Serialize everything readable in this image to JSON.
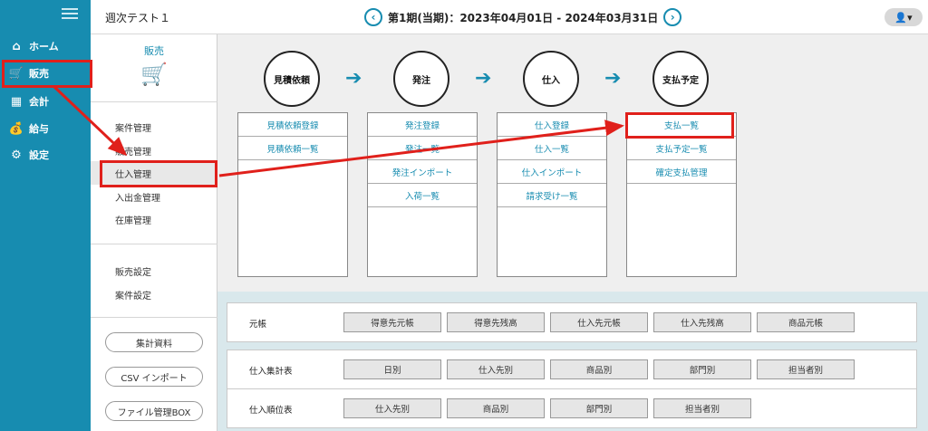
{
  "header": {
    "app_title": "週次テスト１",
    "period": "第1期(当期)：2023年04月01日 - 2024年03月31日",
    "prev_glyph": "‹",
    "next_glyph": "›",
    "user_glyph": "👤▾"
  },
  "nav": {
    "items": [
      {
        "label": "ホーム",
        "icon": "home-icon",
        "glyph": "⌂"
      },
      {
        "label": "販売",
        "icon": "cart-icon",
        "glyph": "🛒"
      },
      {
        "label": "会計",
        "icon": "calculator-icon",
        "glyph": "▦"
      },
      {
        "label": "給与",
        "icon": "money-bag-icon",
        "glyph": "💰"
      },
      {
        "label": "設定",
        "icon": "gear-icon",
        "glyph": "⚙"
      }
    ]
  },
  "submenu": {
    "title": "販売",
    "cart_glyph": "🛒",
    "items": [
      "案件管理",
      "販売管理",
      "仕入管理",
      "入出金管理",
      "在庫管理"
    ],
    "settings": [
      "販売設定",
      "案件設定"
    ],
    "buttons": [
      "集計資料",
      "CSV インポート",
      "ファイル管理BOX"
    ]
  },
  "flow": {
    "steps": [
      {
        "label": "見積依頼",
        "items": [
          "見積依頼登録",
          "見積依頼一覧"
        ]
      },
      {
        "label": "発注",
        "items": [
          "発注登録",
          "発注一覧",
          "発注インポート",
          "入荷一覧"
        ]
      },
      {
        "label": "仕入",
        "items": [
          "仕入登録",
          "仕入一覧",
          "仕入インポート",
          "請求受け一覧"
        ]
      },
      {
        "label": "支払予定",
        "items": [
          "支払一覧",
          "支払予定一覧",
          "確定支払管理"
        ]
      }
    ],
    "arrow_glyph": "➔"
  },
  "reports": [
    {
      "label": "元帳",
      "buttons": [
        "得意先元帳",
        "得意先残高",
        "仕入先元帳",
        "仕入先残高",
        "商品元帳"
      ]
    },
    {
      "label": "仕入集計表",
      "buttons": [
        "日別",
        "仕入先別",
        "商品別",
        "部門別",
        "担当者別"
      ]
    },
    {
      "label": "仕入順位表",
      "buttons": [
        "仕入先別",
        "商品別",
        "部門別",
        "担当者別"
      ]
    }
  ],
  "colors": {
    "brand": "#178cb0",
    "annotation": "#e0201b"
  }
}
